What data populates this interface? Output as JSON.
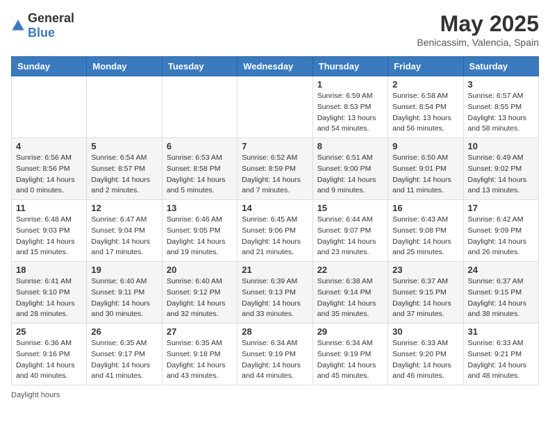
{
  "header": {
    "logo_general": "General",
    "logo_blue": "Blue",
    "title": "May 2025",
    "location": "Benicassim, Valencia, Spain"
  },
  "calendar": {
    "days_of_week": [
      "Sunday",
      "Monday",
      "Tuesday",
      "Wednesday",
      "Thursday",
      "Friday",
      "Saturday"
    ],
    "weeks": [
      [
        {
          "day": "",
          "sunrise": "",
          "sunset": "",
          "daylight": ""
        },
        {
          "day": "",
          "sunrise": "",
          "sunset": "",
          "daylight": ""
        },
        {
          "day": "",
          "sunrise": "",
          "sunset": "",
          "daylight": ""
        },
        {
          "day": "",
          "sunrise": "",
          "sunset": "",
          "daylight": ""
        },
        {
          "day": "1",
          "sunrise": "6:59 AM",
          "sunset": "8:53 PM",
          "daylight": "13 hours and 54 minutes."
        },
        {
          "day": "2",
          "sunrise": "6:58 AM",
          "sunset": "8:54 PM",
          "daylight": "13 hours and 56 minutes."
        },
        {
          "day": "3",
          "sunrise": "6:57 AM",
          "sunset": "8:55 PM",
          "daylight": "13 hours and 58 minutes."
        }
      ],
      [
        {
          "day": "4",
          "sunrise": "6:56 AM",
          "sunset": "8:56 PM",
          "daylight": "14 hours and 0 minutes."
        },
        {
          "day": "5",
          "sunrise": "6:54 AM",
          "sunset": "8:57 PM",
          "daylight": "14 hours and 2 minutes."
        },
        {
          "day": "6",
          "sunrise": "6:53 AM",
          "sunset": "8:58 PM",
          "daylight": "14 hours and 5 minutes."
        },
        {
          "day": "7",
          "sunrise": "6:52 AM",
          "sunset": "8:59 PM",
          "daylight": "14 hours and 7 minutes."
        },
        {
          "day": "8",
          "sunrise": "6:51 AM",
          "sunset": "9:00 PM",
          "daylight": "14 hours and 9 minutes."
        },
        {
          "day": "9",
          "sunrise": "6:50 AM",
          "sunset": "9:01 PM",
          "daylight": "14 hours and 11 minutes."
        },
        {
          "day": "10",
          "sunrise": "6:49 AM",
          "sunset": "9:02 PM",
          "daylight": "14 hours and 13 minutes."
        }
      ],
      [
        {
          "day": "11",
          "sunrise": "6:48 AM",
          "sunset": "9:03 PM",
          "daylight": "14 hours and 15 minutes."
        },
        {
          "day": "12",
          "sunrise": "6:47 AM",
          "sunset": "9:04 PM",
          "daylight": "14 hours and 17 minutes."
        },
        {
          "day": "13",
          "sunrise": "6:46 AM",
          "sunset": "9:05 PM",
          "daylight": "14 hours and 19 minutes."
        },
        {
          "day": "14",
          "sunrise": "6:45 AM",
          "sunset": "9:06 PM",
          "daylight": "14 hours and 21 minutes."
        },
        {
          "day": "15",
          "sunrise": "6:44 AM",
          "sunset": "9:07 PM",
          "daylight": "14 hours and 23 minutes."
        },
        {
          "day": "16",
          "sunrise": "6:43 AM",
          "sunset": "9:08 PM",
          "daylight": "14 hours and 25 minutes."
        },
        {
          "day": "17",
          "sunrise": "6:42 AM",
          "sunset": "9:09 PM",
          "daylight": "14 hours and 26 minutes."
        }
      ],
      [
        {
          "day": "18",
          "sunrise": "6:41 AM",
          "sunset": "9:10 PM",
          "daylight": "14 hours and 28 minutes."
        },
        {
          "day": "19",
          "sunrise": "6:40 AM",
          "sunset": "9:11 PM",
          "daylight": "14 hours and 30 minutes."
        },
        {
          "day": "20",
          "sunrise": "6:40 AM",
          "sunset": "9:12 PM",
          "daylight": "14 hours and 32 minutes."
        },
        {
          "day": "21",
          "sunrise": "6:39 AM",
          "sunset": "9:13 PM",
          "daylight": "14 hours and 33 minutes."
        },
        {
          "day": "22",
          "sunrise": "6:38 AM",
          "sunset": "9:14 PM",
          "daylight": "14 hours and 35 minutes."
        },
        {
          "day": "23",
          "sunrise": "6:37 AM",
          "sunset": "9:15 PM",
          "daylight": "14 hours and 37 minutes."
        },
        {
          "day": "24",
          "sunrise": "6:37 AM",
          "sunset": "9:15 PM",
          "daylight": "14 hours and 38 minutes."
        }
      ],
      [
        {
          "day": "25",
          "sunrise": "6:36 AM",
          "sunset": "9:16 PM",
          "daylight": "14 hours and 40 minutes."
        },
        {
          "day": "26",
          "sunrise": "6:35 AM",
          "sunset": "9:17 PM",
          "daylight": "14 hours and 41 minutes."
        },
        {
          "day": "27",
          "sunrise": "6:35 AM",
          "sunset": "9:18 PM",
          "daylight": "14 hours and 43 minutes."
        },
        {
          "day": "28",
          "sunrise": "6:34 AM",
          "sunset": "9:19 PM",
          "daylight": "14 hours and 44 minutes."
        },
        {
          "day": "29",
          "sunrise": "6:34 AM",
          "sunset": "9:19 PM",
          "daylight": "14 hours and 45 minutes."
        },
        {
          "day": "30",
          "sunrise": "6:33 AM",
          "sunset": "9:20 PM",
          "daylight": "14 hours and 46 minutes."
        },
        {
          "day": "31",
          "sunrise": "6:33 AM",
          "sunset": "9:21 PM",
          "daylight": "14 hours and 48 minutes."
        }
      ]
    ]
  },
  "footer": {
    "note": "Daylight hours"
  }
}
